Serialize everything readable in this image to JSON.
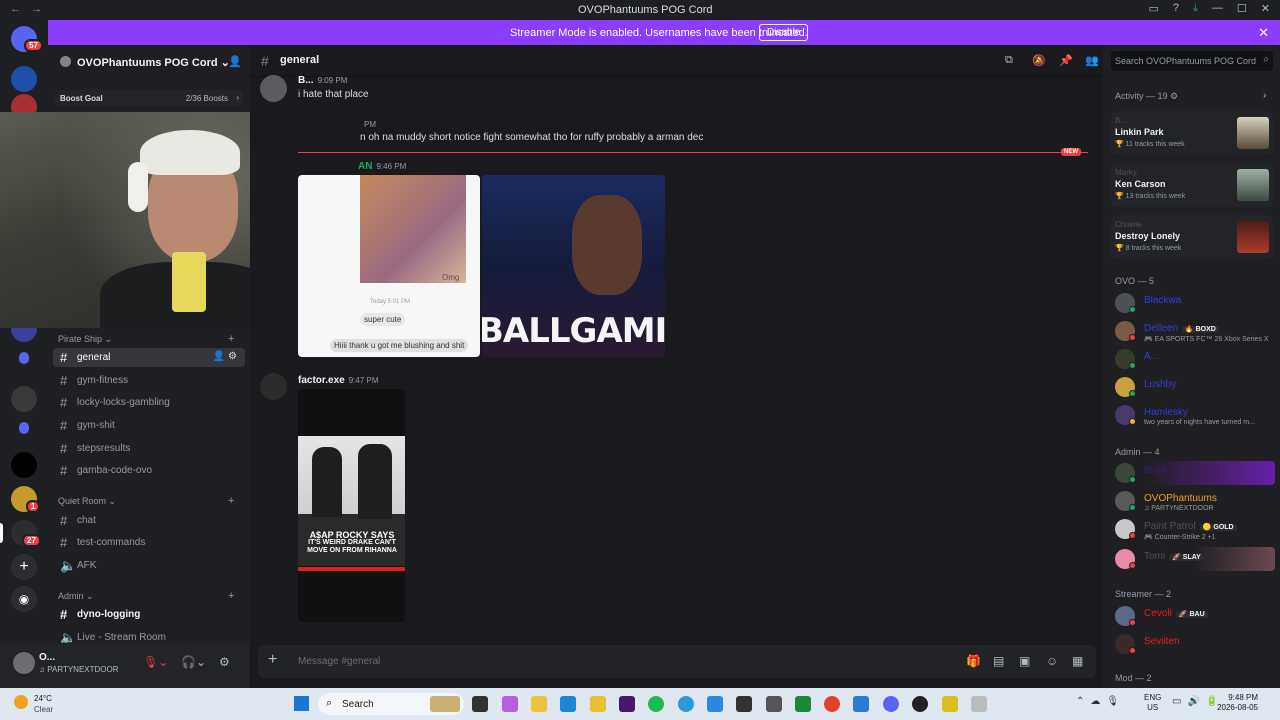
{
  "window": {
    "title": "OVOPhantuums POG Cord",
    "nav_back": "←",
    "nav_forward": "→"
  },
  "banner": {
    "message": "Streamer Mode is enabled. Usernames have been truncated.",
    "button": "Disable"
  },
  "guilds": {
    "badges": [
      "57",
      "1",
      "27"
    ]
  },
  "server": {
    "name": "OVOPhantuums POG Cord",
    "boost_label": "Boost Goal",
    "boost_count": "2/36 Boosts"
  },
  "channels": {
    "categories": [
      {
        "name": "Pirate Ship",
        "items": [
          "general",
          "gym-fitness",
          "locky-locks-gambling",
          "gym-shit",
          "stepsresults",
          "gamba-code-ovo"
        ]
      },
      {
        "name": "Quiet Room",
        "items": [
          "chat",
          "test-commands",
          "AFK"
        ]
      },
      {
        "name": "Admin",
        "items": [
          "dyno-logging",
          "Live - Stream Room"
        ]
      }
    ]
  },
  "user_panel": {
    "name": "O...",
    "status": "PARTYNEXTDOOR"
  },
  "chat": {
    "channel": "general",
    "messages": [
      {
        "author": "B...",
        "time": "9:09 PM",
        "text": "i hate that place"
      },
      {
        "author": "",
        "time": "PM",
        "text": "n oh na muddy short notice fight somewhat tho for ruffy probably a arman dec"
      },
      {
        "author": "AN",
        "time": "9:46 PM",
        "text": ""
      },
      {
        "author": "factor.exe",
        "time": "9:47 PM",
        "text": ""
      }
    ],
    "new_label": "NEW",
    "image1": {
      "omg": "Omg",
      "date": "Today 5:01 PM",
      "bubble1": "super cute",
      "bubble2": "Hiiii thank u got me blushing and shit"
    },
    "image2": {
      "text": "BALLGAMI"
    },
    "image3": {
      "line1": "A$AP ROCKY SAYS",
      "line2": "IT'S WEIRD DRAKE CAN'T MOVE ON FROM RIHANNA"
    },
    "composer_placeholder": "Message #general"
  },
  "members_panel": {
    "search_placeholder": "Search OVOPhantuums POG Cord",
    "activity_header": "Activity — 19",
    "activity": [
      {
        "who": "B...",
        "title": "Linkin Park",
        "sub": "11 tracks this week"
      },
      {
        "who": "Marky",
        "title": "Ken Carson",
        "sub": "13 tracks this week"
      },
      {
        "who": "Chowie",
        "title": "Destroy Lonely",
        "sub": "8 tracks this week"
      }
    ],
    "groups": [
      {
        "name": "OVO — 5",
        "members": [
          {
            "name": "Blackwa",
            "status": "",
            "tag": ""
          },
          {
            "name": "Delleen",
            "status": "EA SPORTS FC™ 26 Xbox Series X",
            "tag": "BOXD"
          },
          {
            "name": "A...",
            "status": "",
            "tag": ""
          },
          {
            "name": "Lushby",
            "status": "",
            "tag": ""
          },
          {
            "name": "Hamlesky",
            "status": "two years of nights have turned m...",
            "tag": ""
          }
        ]
      },
      {
        "name": "Admin — 4",
        "members": [
          {
            "name": "Blurk",
            "status": "",
            "tag": ""
          },
          {
            "name": "OVOPhantuums",
            "status": "PARTYNEXTDOOR",
            "tag": ""
          },
          {
            "name": "Paint Patrol",
            "status": "Counter-Strike 2 +1",
            "tag": "GOLD"
          },
          {
            "name": "Tomi",
            "status": "",
            "tag": "SLAY"
          }
        ]
      },
      {
        "name": "Streamer — 2",
        "members": [
          {
            "name": "Cevoli",
            "status": "",
            "tag": "BAU"
          },
          {
            "name": "Seviiten",
            "status": "",
            "tag": ""
          }
        ]
      },
      {
        "name": "Mod — 2",
        "members": []
      }
    ]
  },
  "taskbar": {
    "temp": "24°C",
    "condition": "Clear",
    "search": "Search",
    "lang1": "ENG",
    "lang2": "US",
    "time": "9:48 PM",
    "date": "2026-08-05"
  },
  "colors": {
    "accent": "#8b3dff",
    "danger": "#f23f42",
    "online": "#23a55a",
    "background": "#1a1a1e"
  }
}
